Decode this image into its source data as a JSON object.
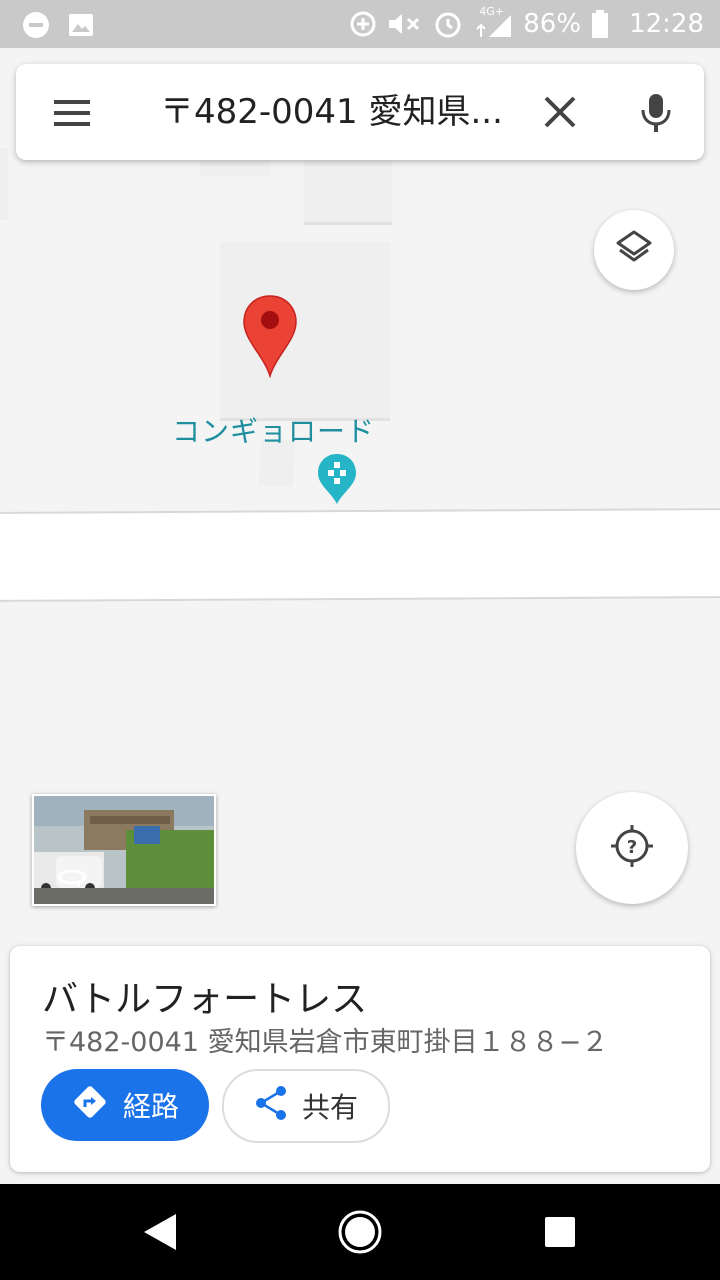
{
  "status_bar": {
    "battery": "86%",
    "time": "12:28",
    "network": "4G+",
    "icons": [
      "minus-circle-icon",
      "image-icon",
      "data-saver-icon",
      "mute-icon",
      "alarm-icon",
      "signal-icon",
      "battery-icon"
    ]
  },
  "search": {
    "query": "〒482-0041 愛知県...",
    "menu_icon": "hamburger-menu-icon",
    "clear_icon": "close-icon",
    "voice_icon": "microphone-icon"
  },
  "map": {
    "label": "コンギョロード",
    "marker_color": "#ea4335",
    "poi_color": "#26b5c6",
    "layers_icon": "layers-icon",
    "location_icon": "location-unknown-icon"
  },
  "place_card": {
    "name": "バトルフォートレス",
    "address": "〒482-0041 愛知県岩倉市東町掛目１８８−２",
    "directions_label": "経路",
    "share_label": "共有",
    "accent": "#1a73e8"
  },
  "nav_bar": {
    "icons": [
      "back-icon",
      "home-icon",
      "recents-icon"
    ]
  }
}
